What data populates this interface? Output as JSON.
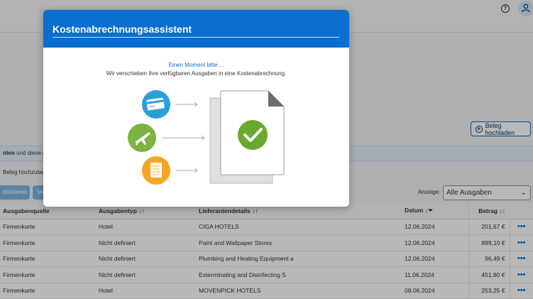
{
  "shell": {
    "help_icon": "help-icon",
    "help_glyph": "?",
    "avatar_icon": "user-icon"
  },
  "page": {
    "upload_button": "Beleg hochladen",
    "info_strip_bold": "nten",
    "info_strip_rest": " und diese Au",
    "hint_text": "Beleg hochzulad",
    "toolbar_btn1": "mbinieren",
    "toolbar_btn2": "Ve",
    "filter_label": "Anzeige:",
    "filter_value": "Alle Ausgaben"
  },
  "table": {
    "headers": {
      "source": "Ausgabenquelle",
      "type": "Ausgabentyp",
      "vendor": "Lieferantendetails",
      "date": "Datum",
      "amount": "Betrag"
    },
    "rows": [
      {
        "source": "Firmenkarte",
        "type": "Hotel",
        "vendor": "CIGA HOTELS",
        "date": "12.06.2024",
        "amount": "201,67 €"
      },
      {
        "source": "Firmenkarte",
        "type": "Nicht definiert",
        "vendor": "Paint and Wallpaper Stores",
        "date": "12.06.2024",
        "amount": "899,10 €"
      },
      {
        "source": "Firmenkarte",
        "type": "Nicht definiert",
        "vendor": "Plumbing and Heating Equipment a",
        "date": "12.06.2024",
        "amount": "96,49 €"
      },
      {
        "source": "Firmenkarte",
        "type": "Nicht definiert",
        "vendor": "Exterminating and Disinfecting S",
        "date": "11.06.2024",
        "amount": "451,80 €"
      },
      {
        "source": "Firmenkarte",
        "type": "Hotel",
        "vendor": "MOVENPICK HOTELS",
        "date": "08.06.2024",
        "amount": "253,25 €"
      }
    ]
  },
  "dialog": {
    "title": "Kostenabrechnungsassistent",
    "message_status": "Einen Moment bitte ...",
    "message_detail": "Wir verschieben Ihre verfügbaren Ausgaben in eine Kostenabrechnung.",
    "icons": [
      "credit-card-icon",
      "airplane-icon",
      "receipt-icon",
      "checkmark-icon"
    ]
  },
  "colors": {
    "brand_blue": "#0a6ed1",
    "card_blue": "#2c9fdb",
    "flight_green": "#7cb342",
    "receipt_orange": "#f5a623",
    "check_green": "#6aa82e"
  }
}
